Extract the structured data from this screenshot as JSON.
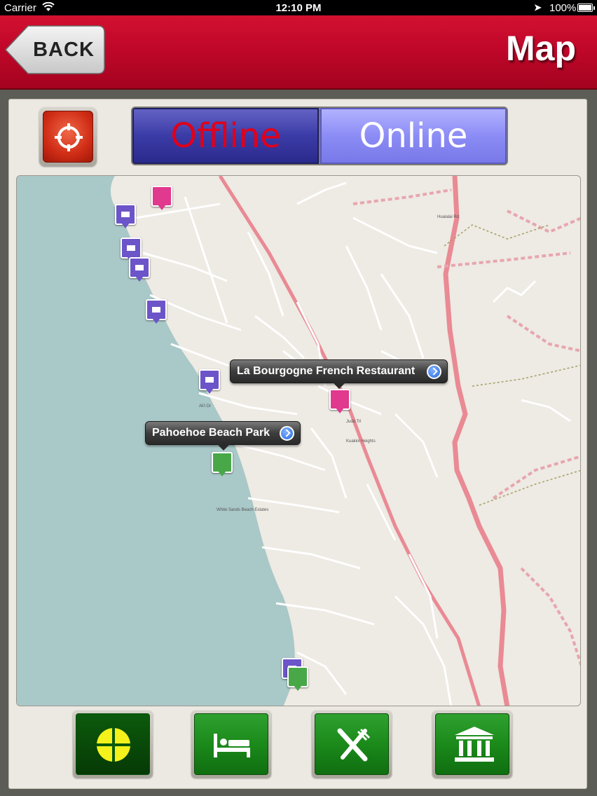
{
  "status_bar": {
    "carrier": "Carrier",
    "time": "12:10 PM",
    "battery": "100%",
    "wifi_icon": "wifi-icon",
    "location_icon": "location-arrow-icon"
  },
  "nav": {
    "back_label": "BACK",
    "title": "Map"
  },
  "toolbar": {
    "locate_icon": "crosshair-icon",
    "offline_label": "Offline",
    "online_label": "Online",
    "selected": "Offline"
  },
  "map": {
    "callouts": [
      {
        "title": "La Bourgogne French Restaurant"
      },
      {
        "title": "Pahoehoe Beach Park"
      }
    ],
    "road_labels": [
      "Kuakini Hwy",
      "Queen Kaahumanu Hwy",
      "Ali'i Dr",
      "Kuakini Heights",
      "Judd Trl",
      "Hualalai Rd",
      "White Sands Beach Estates",
      "Kahaluu Rd"
    ]
  },
  "categories": [
    {
      "name": "all",
      "icon": "crosshair-circle-icon",
      "active": true
    },
    {
      "name": "hotels",
      "icon": "bed-icon",
      "active": false
    },
    {
      "name": "restaurants",
      "icon": "fork-knife-icon",
      "active": false
    },
    {
      "name": "attractions",
      "icon": "museum-icon",
      "active": false
    }
  ],
  "colors": {
    "nav_red": "#c0072a",
    "offline_blue": "#3b3ba7",
    "online_blue": "#8c8cf6",
    "category_green": "#1b8a1b",
    "water": "#a9c8c8"
  }
}
